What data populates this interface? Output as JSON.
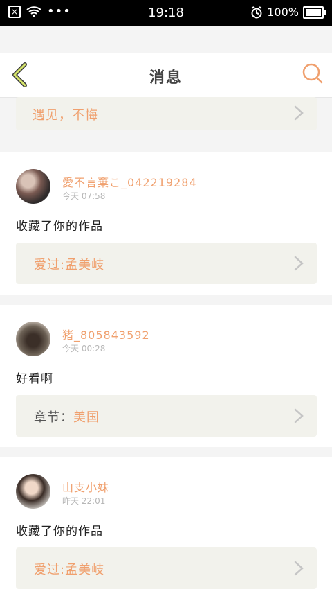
{
  "status_bar": {
    "time": "19:18",
    "battery_percent": "100%"
  },
  "header": {
    "title": "消息",
    "back_icon": "chevron-left-icon",
    "search_icon": "search-icon"
  },
  "top_link": {
    "text": "遇见，不悔",
    "chevron_icon": "chevron-right-icon"
  },
  "messages": [
    {
      "user": "愛不言棄こ_042219284",
      "time": "今天 07:58",
      "content": "收藏了你的作品",
      "link_label": "",
      "link_text": "爱过:孟美岐"
    },
    {
      "user": "猪_805843592",
      "time": "今天 00:28",
      "content": "好看啊",
      "link_label": "章节：",
      "link_text": "美国"
    },
    {
      "user": "山支小妹",
      "time": "昨天 22:01",
      "content": "收藏了你的作品",
      "link_label": "",
      "link_text": "爱过:孟美岐"
    }
  ],
  "colors": {
    "accent": "#f0a06e",
    "background": "#f4f4f4",
    "card": "#ffffff",
    "link_bg": "#f2f2ec"
  }
}
